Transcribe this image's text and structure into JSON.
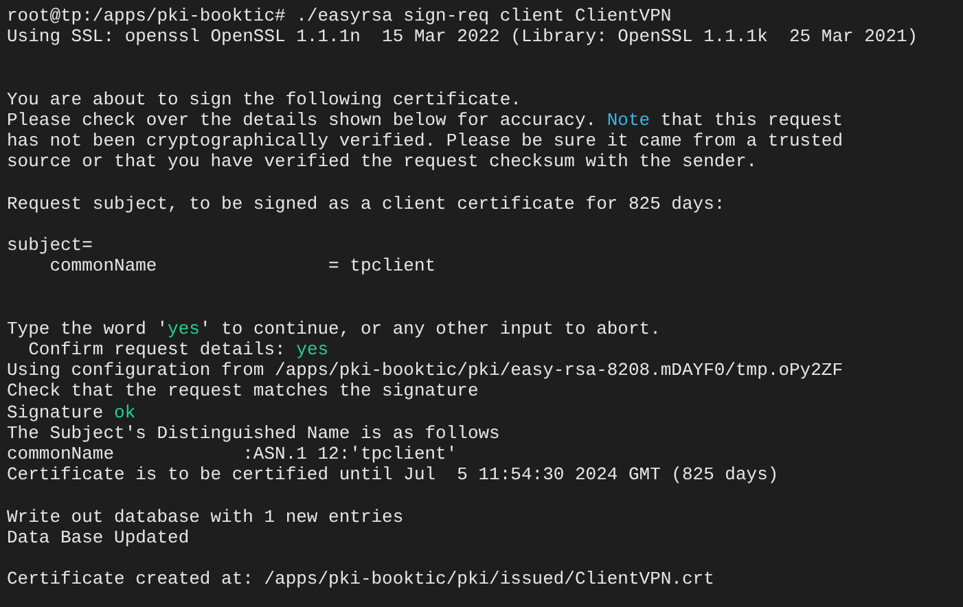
{
  "terminal": {
    "lines": [
      {
        "kind": "command",
        "segments": [
          {
            "kind": "plain",
            "text": "root@tp:/apps/pki-booktic# ./easyrsa sign-req client ClientVPN"
          }
        ]
      },
      {
        "kind": "output",
        "segments": [
          {
            "kind": "plain",
            "text": "Using SSL: openssl OpenSSL 1.1.1n  15 Mar 2022 (Library: OpenSSL 1.1.1k  25 Mar 2021)"
          }
        ]
      },
      {
        "kind": "blank"
      },
      {
        "kind": "blank"
      },
      {
        "kind": "output",
        "segments": [
          {
            "kind": "plain",
            "text": "You are about to sign the following certificate."
          }
        ]
      },
      {
        "kind": "output",
        "segments": [
          {
            "kind": "plain",
            "text": "Please check over the details shown below for accuracy. "
          },
          {
            "kind": "note",
            "text": "Note"
          },
          {
            "kind": "plain",
            "text": " that this request"
          }
        ]
      },
      {
        "kind": "output",
        "segments": [
          {
            "kind": "plain",
            "text": "has not been cryptographically verified. Please be sure it came from a trusted"
          }
        ]
      },
      {
        "kind": "output",
        "segments": [
          {
            "kind": "plain",
            "text": "source or that you have verified the request checksum with the sender."
          }
        ]
      },
      {
        "kind": "blank"
      },
      {
        "kind": "output",
        "segments": [
          {
            "kind": "plain",
            "text": "Request subject, to be signed as a client certificate for 825 days:"
          }
        ]
      },
      {
        "kind": "blank"
      },
      {
        "kind": "output",
        "segments": [
          {
            "kind": "plain",
            "text": "subject="
          }
        ]
      },
      {
        "kind": "output",
        "segments": [
          {
            "kind": "plain",
            "text": "    commonName                = tpclient"
          }
        ]
      },
      {
        "kind": "blank"
      },
      {
        "kind": "blank"
      },
      {
        "kind": "output",
        "segments": [
          {
            "kind": "plain",
            "text": "Type the word '"
          },
          {
            "kind": "ok",
            "text": "yes"
          },
          {
            "kind": "plain",
            "text": "' to continue, or any other input to abort."
          }
        ]
      },
      {
        "kind": "output",
        "segments": [
          {
            "kind": "plain",
            "text": "  Confirm request details: "
          },
          {
            "kind": "ok",
            "text": "yes"
          }
        ]
      },
      {
        "kind": "output",
        "segments": [
          {
            "kind": "plain",
            "text": "Using configuration from /apps/pki-booktic/pki/easy-rsa-8208.mDAYF0/tmp.oPy2ZF"
          }
        ]
      },
      {
        "kind": "output",
        "segments": [
          {
            "kind": "plain",
            "text": "Check that the request matches the signature"
          }
        ]
      },
      {
        "kind": "output",
        "segments": [
          {
            "kind": "plain",
            "text": "Signature "
          },
          {
            "kind": "ok",
            "text": "ok"
          }
        ]
      },
      {
        "kind": "output",
        "segments": [
          {
            "kind": "plain",
            "text": "The Subject's Distinguished Name is as follows"
          }
        ]
      },
      {
        "kind": "output",
        "segments": [
          {
            "kind": "plain",
            "text": "commonName            :ASN.1 12:'tpclient'"
          }
        ]
      },
      {
        "kind": "output",
        "segments": [
          {
            "kind": "plain",
            "text": "Certificate is to be certified until Jul  5 11:54:30 2024 GMT (825 days)"
          }
        ]
      },
      {
        "kind": "blank"
      },
      {
        "kind": "output",
        "segments": [
          {
            "kind": "plain",
            "text": "Write out database with 1 new entries"
          }
        ]
      },
      {
        "kind": "output",
        "segments": [
          {
            "kind": "plain",
            "text": "Data Base Updated"
          }
        ]
      },
      {
        "kind": "blank"
      },
      {
        "kind": "output",
        "segments": [
          {
            "kind": "plain",
            "text": "Certificate created at: /apps/pki-booktic/pki/issued/ClientVPN.crt"
          }
        ]
      }
    ]
  }
}
